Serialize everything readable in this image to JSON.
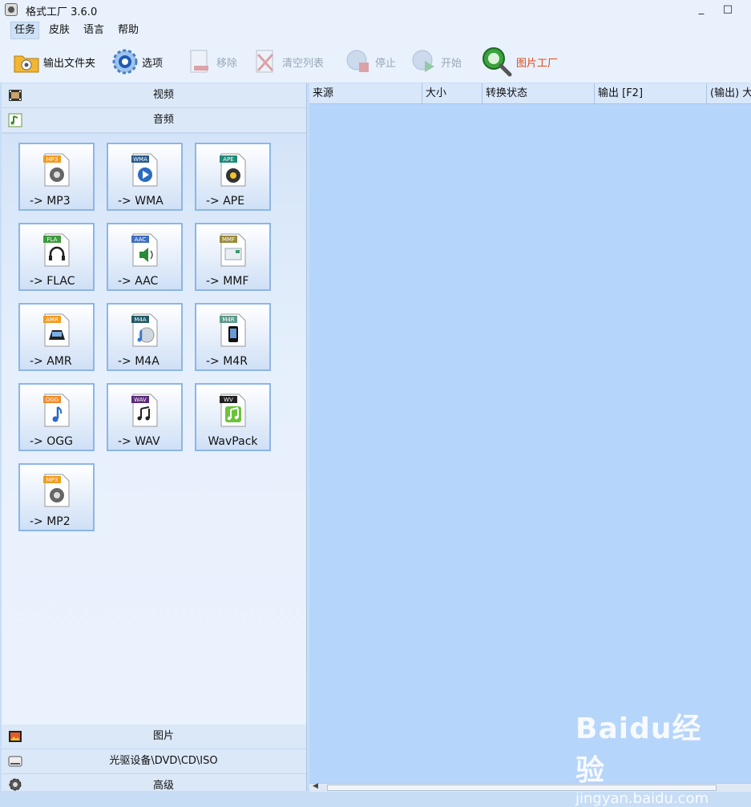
{
  "window": {
    "title": "格式工厂 3.6.0",
    "minimize": "_",
    "maximize": "□"
  },
  "menu": [
    {
      "label": "任务"
    },
    {
      "label": "皮肤"
    },
    {
      "label": "语言"
    },
    {
      "label": "帮助"
    }
  ],
  "toolbar": {
    "output_folder": "输出文件夹",
    "options": "选项",
    "remove": "移除",
    "clear_list": "清空列表",
    "stop": "停止",
    "start": "开始",
    "picture_factory": "图片工厂"
  },
  "sidebar": {
    "categories": {
      "video": "视频",
      "audio": "音频",
      "picture": "图片",
      "rom": "光驱设备\\DVD\\CD\\ISO",
      "advanced": "高级"
    },
    "audio_formats": [
      {
        "label": "-> MP3",
        "badge": "MP3",
        "badge_color": "#f39a1f"
      },
      {
        "label": "-> WMA",
        "badge": "WMA",
        "badge_color": "#2a5a8c"
      },
      {
        "label": "-> APE",
        "badge": "APE",
        "badge_color": "#1f8a7a"
      },
      {
        "label": "-> FLAC",
        "badge": "FLA",
        "badge_color": "#3d9a3d"
      },
      {
        "label": "-> AAC",
        "badge": "AAC",
        "badge_color": "#3f6fc0"
      },
      {
        "label": "-> MMF",
        "badge": "MMF",
        "badge_color": "#9a8a3a"
      },
      {
        "label": "-> AMR",
        "badge": "AMR",
        "badge_color": "#f39a1f"
      },
      {
        "label": "-> M4A",
        "badge": "M4A",
        "badge_color": "#1f5a66"
      },
      {
        "label": "-> M4R",
        "badge": "M4R",
        "badge_color": "#5c9a8a"
      },
      {
        "label": "-> OGG",
        "badge": "OGG",
        "badge_color": "#f08a2a"
      },
      {
        "label": "-> WAV",
        "badge": "WAV",
        "badge_color": "#5a2a7a"
      },
      {
        "label": "WavPack",
        "badge": "WV",
        "badge_color": "#222222"
      },
      {
        "label": "-> MP2",
        "badge": "MP3",
        "badge_color": "#f39a1f"
      }
    ]
  },
  "table": {
    "columns": [
      "来源",
      "大小",
      "转换状态",
      "输出 [F2]",
      "(输出) 大"
    ]
  },
  "watermark": {
    "logo": "Baidu经验",
    "url": "jingyan.baidu.com"
  }
}
